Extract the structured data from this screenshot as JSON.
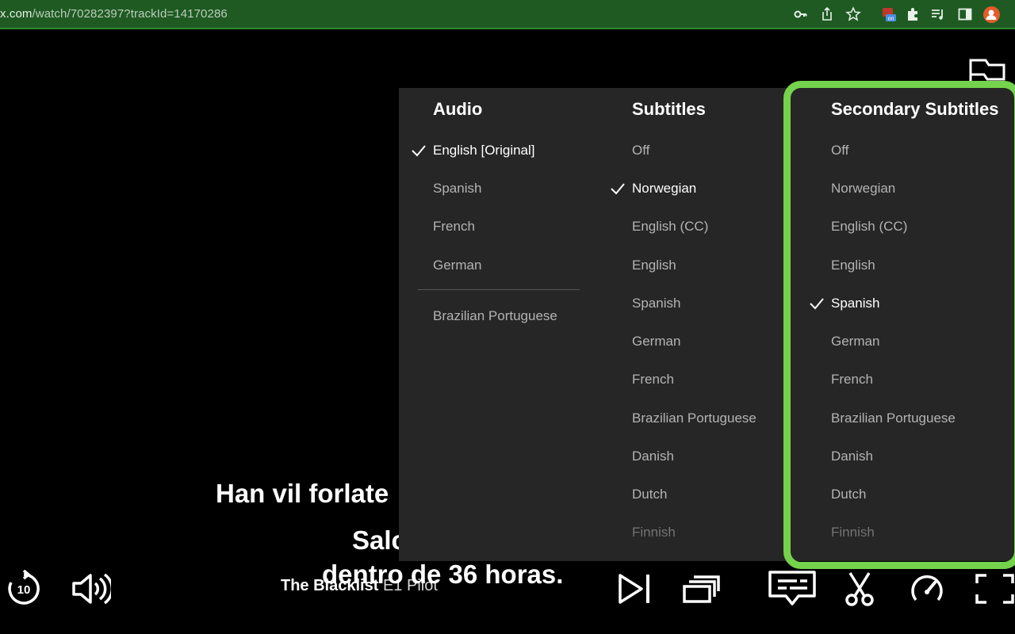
{
  "browser": {
    "url_host_fragment": "x.com",
    "url_path": "/watch/70282397?trackId=14170286",
    "extension_badge": "on"
  },
  "subtitles_on_screen": {
    "line1": "Han vil forlate",
    "line2": "Salc",
    "line3": "dentro de 36 horas."
  },
  "title": {
    "show": "The Blacklist",
    "episode": "E1",
    "episode_title": "Pilot"
  },
  "panel": {
    "audio": {
      "heading": "Audio",
      "options": [
        "English [Original]",
        "Spanish",
        "French",
        "German",
        "Brazilian Portuguese"
      ],
      "selected": "English [Original]"
    },
    "subtitles": {
      "heading": "Subtitles",
      "options": [
        "Off",
        "Norwegian",
        "English (CC)",
        "English",
        "Spanish",
        "German",
        "French",
        "Brazilian Portuguese",
        "Danish",
        "Dutch",
        "Finnish"
      ],
      "selected": "Norwegian"
    },
    "secondary_subtitles": {
      "heading": "Secondary Subtitles",
      "options": [
        "Off",
        "Norwegian",
        "English (CC)",
        "English",
        "Spanish",
        "German",
        "French",
        "Brazilian Portuguese",
        "Danish",
        "Dutch",
        "Finnish"
      ],
      "selected": "Spanish"
    }
  },
  "controls": {
    "skip_back_seconds": "10"
  },
  "colors": {
    "highlight": "#75d24c",
    "panel_bg": "#262626",
    "browser_bar": "#1f5a23"
  }
}
